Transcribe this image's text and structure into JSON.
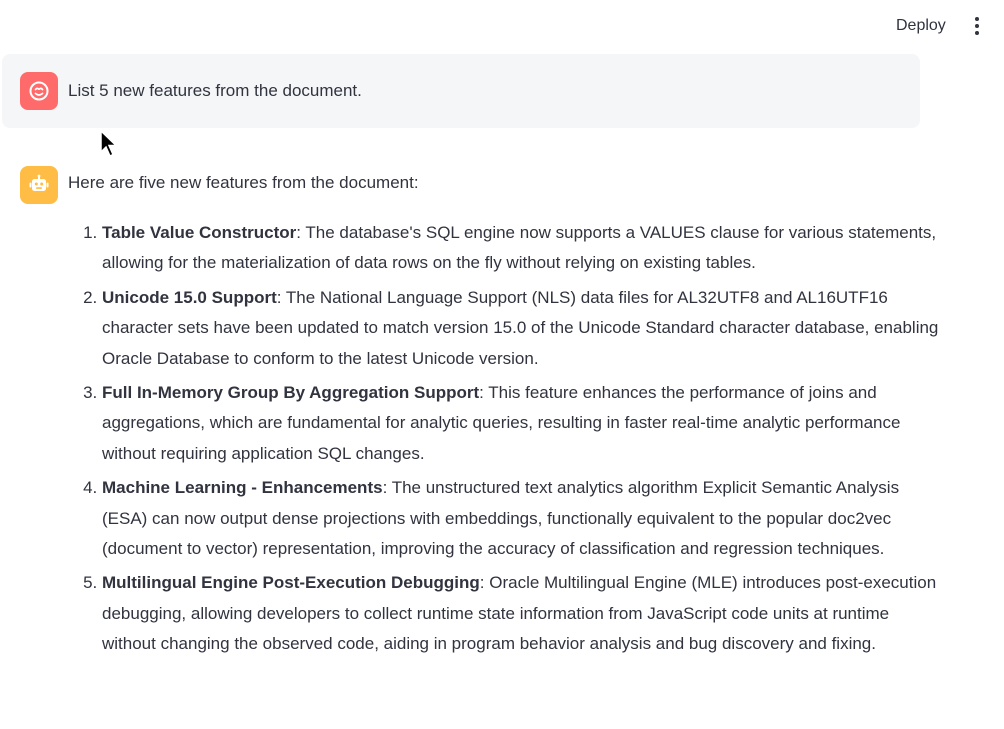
{
  "header": {
    "deploy_label": "Deploy"
  },
  "user_message": {
    "text": "List 5 new features from the document."
  },
  "assistant_message": {
    "intro": "Here are five new features from the document:",
    "features": [
      {
        "title": "Table Value Constructor",
        "description": ": The database's SQL engine now supports a VALUES clause for various statements, allowing for the materialization of data rows on the fly without relying on existing tables."
      },
      {
        "title": "Unicode 15.0 Support",
        "description": ": The National Language Support (NLS) data files for AL32UTF8 and AL16UTF16 character sets have been updated to match version 15.0 of the Unicode Standard character database, enabling Oracle Database to conform to the latest Unicode version."
      },
      {
        "title": "Full In-Memory Group By Aggregation Support",
        "description": ": This feature enhances the performance of joins and aggregations, which are fundamental for analytic queries, resulting in faster real-time analytic performance without requiring application SQL changes."
      },
      {
        "title": "Machine Learning - Enhancements",
        "description": ": The unstructured text analytics algorithm Explicit Semantic Analysis (ESA) can now output dense projections with embeddings, functionally equivalent to the popular doc2vec (document to vector) representation, improving the accuracy of classification and regression techniques."
      },
      {
        "title": "Multilingual Engine Post-Execution Debugging",
        "description": ": Oracle Multilingual Engine (MLE) introduces post-execution debugging, allowing developers to collect runtime state information from JavaScript code units at runtime without changing the observed code, aiding in program behavior analysis and bug discovery and fixing."
      }
    ]
  },
  "colors": {
    "user_avatar": "#ff6b6b",
    "bot_avatar": "#ffbd45",
    "user_bubble": "#f5f6f8",
    "text": "#31333f"
  }
}
